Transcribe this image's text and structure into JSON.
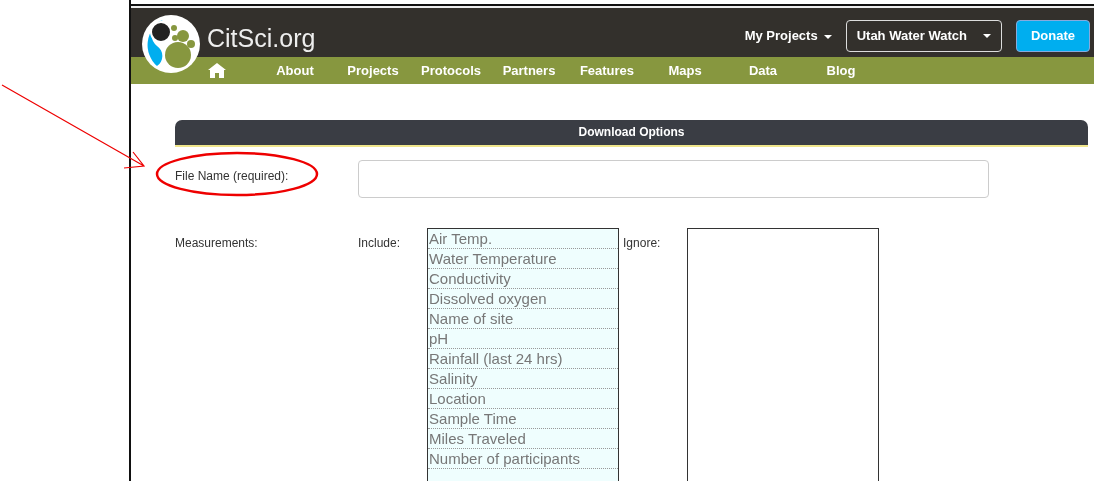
{
  "header": {
    "logo_text": "CitSci.org",
    "my_projects": "My Projects",
    "project_select": "Utah Water Watch",
    "donate": "Donate"
  },
  "nav": [
    "About",
    "Projects",
    "Protocols",
    "Partners",
    "Features",
    "Maps",
    "Data",
    "Blog"
  ],
  "section_title": "Download Options",
  "file_name": {
    "label": "File Name (required):"
  },
  "measurements": {
    "label": "Measurements:",
    "include_label": "Include:",
    "ignore_label": "Ignore:",
    "include": [
      "Air Temp.",
      "Water Temperature",
      "Conductivity",
      "Dissolved oxygen",
      "Name of site",
      "pH",
      "Rainfall (last 24 hrs)",
      "Salinity",
      "Location",
      "Sample Time",
      "Miles Traveled",
      "Number of participants"
    ]
  }
}
